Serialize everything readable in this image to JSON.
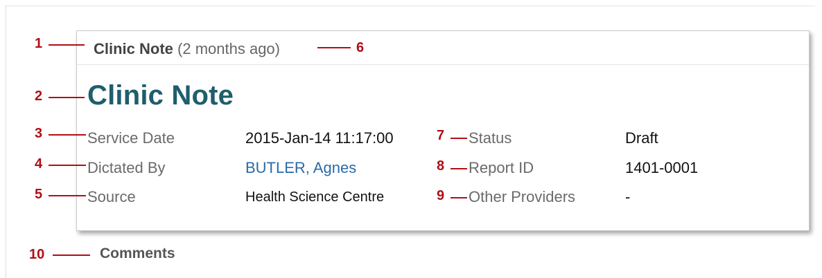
{
  "card": {
    "tab_title": "Clinic Note",
    "tab_time": "(2 months ago)",
    "note_title": "Clinic Note"
  },
  "fields": {
    "service_date_label": "Service Date",
    "service_date_value": "2015-Jan-14 11:17:00",
    "dictated_by_label": "Dictated By",
    "dictated_by_value": "BUTLER, Agnes",
    "source_label": "Source",
    "source_value": "Health Science Centre",
    "status_label": "Status",
    "status_value": "Draft",
    "report_id_label": "Report ID",
    "report_id_value": "1401-0001",
    "other_providers_label": "Other Providers",
    "other_providers_value": "-"
  },
  "comments_label": "Comments",
  "callouts": [
    "1",
    "2",
    "3",
    "4",
    "5",
    "6",
    "7",
    "8",
    "9",
    "10"
  ],
  "colors": {
    "callout": "#b10d16",
    "title": "#1f5e6c",
    "link": "#2a6aa9"
  }
}
